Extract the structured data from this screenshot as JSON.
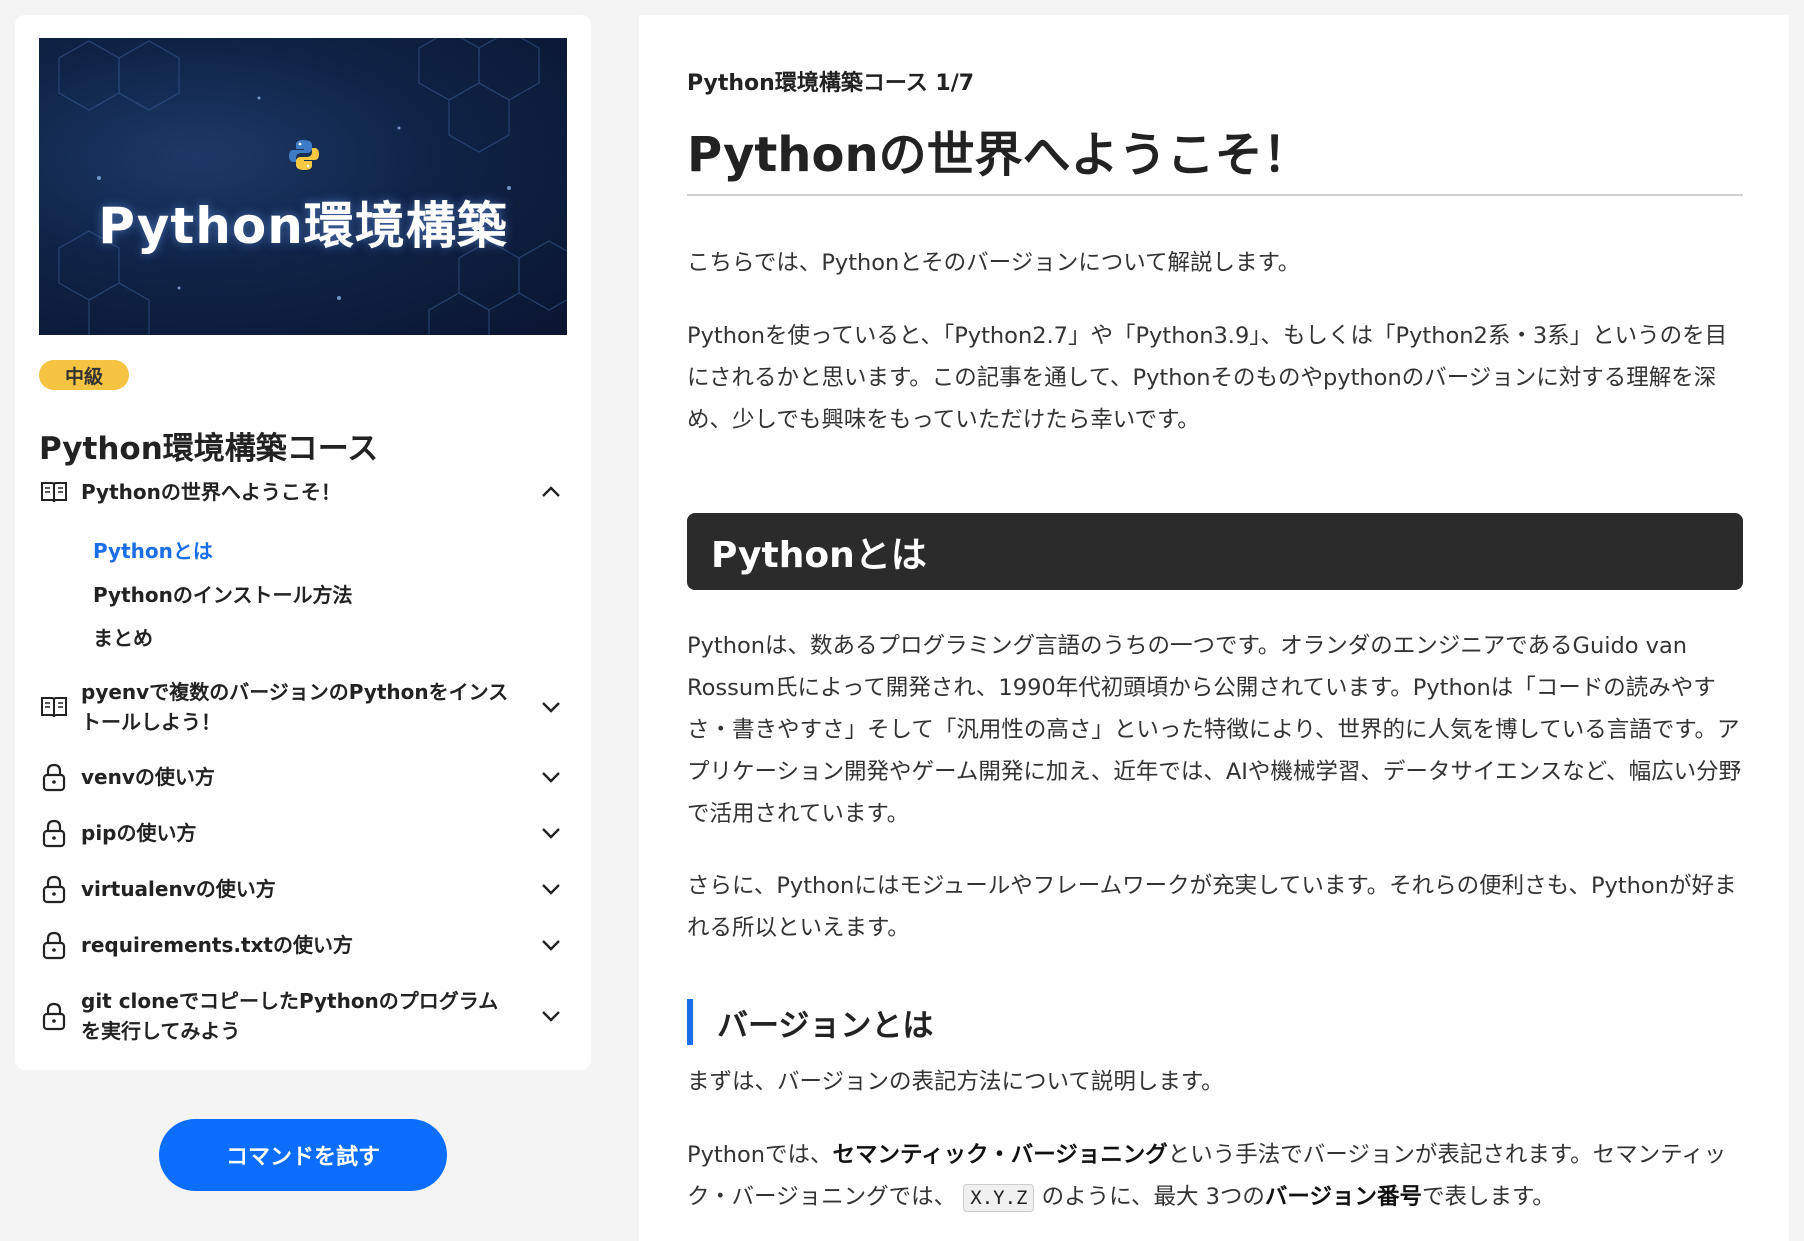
{
  "sidebar": {
    "banner_title": "Python環境構築",
    "level": "中級",
    "course_title": "Python環境構築コース",
    "sections": [
      {
        "label": "Pythonの世界へようこそ！",
        "icon": "book-icon",
        "expanded": true
      },
      {
        "label": "pyenvで複数のバージョンのPythonをインストールしよう！",
        "icon": "book-icon",
        "expanded": false
      },
      {
        "label": "venvの使い方",
        "icon": "lock-icon",
        "expanded": false
      },
      {
        "label": "pipの使い方",
        "icon": "lock-icon",
        "expanded": false
      },
      {
        "label": "virtualenvの使い方",
        "icon": "lock-icon",
        "expanded": false
      },
      {
        "label": "requirements.txtの使い方",
        "icon": "lock-icon",
        "expanded": false
      },
      {
        "label": "git cloneでコピーしたPythonのプログラムを実行してみよう",
        "icon": "lock-icon",
        "expanded": false
      }
    ],
    "subsections": [
      {
        "label": "Pythonとは",
        "active": true
      },
      {
        "label": "Pythonのインストール方法",
        "active": false
      },
      {
        "label": "まとめ",
        "active": false
      }
    ],
    "command_button": "コマンドを試す"
  },
  "main": {
    "breadcrumb": "Python環境構築コース 1/7",
    "title": "Pythonの世界へようこそ！",
    "intro1": "こちらでは、Pythonとそのバージョンについて解説します。",
    "intro2": "Pythonを使っていると、「Python2.7」や「Python3.9」、もしくは「Python2系・3系」というのを目にされるかと思います。この記事を通して、Pythonそのものやpythonのバージョンに対する理解を深め、少しでも興味をもっていただけたら幸いです。",
    "h2": "Pythonとは",
    "body1": "Pythonは、数あるプログラミング言語のうちの一つです。オランダのエンジニアであるGuido van Rossum氏によって開発され、1990年代初頭頃から公開されています。Pythonは「コードの読みやすさ・書きやすさ」そして「汎用性の高さ」といった特徴により、世界的に人気を博している言語です。アプリケーション開発やゲーム開発に加え、近年では、AIや機械学習、データサイエンスなど、幅広い分野で活用されています。",
    "body2": "さらに、Pythonにはモジュールやフレームワークが充実しています。それらの便利さも、Pythonが好まれる所以といえます。",
    "h3": "バージョンとは",
    "body3": "まずは、バージョンの表記方法について説明します。",
    "body4_a": "Pythonでは、",
    "body4_b": "セマンティック・バージョニング",
    "body4_c": "という手法でバージョンが表記されます。セマンティック・バージョニングでは、",
    "body4_code": "X.Y.Z",
    "body4_d": "のように、最大 3つの",
    "body4_e": "バージョン番号",
    "body4_f": "で表します。"
  },
  "colors": {
    "accent": "#1a6fe6",
    "badge": "#f6c343",
    "button": "#0d6efd",
    "h2_bg": "#2b2b2b"
  }
}
